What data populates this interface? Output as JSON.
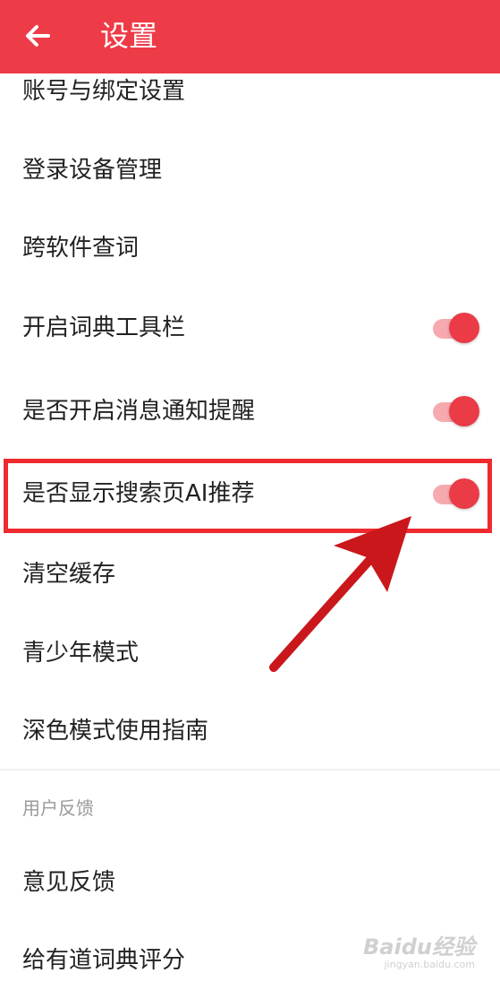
{
  "header": {
    "title": "设置",
    "back_icon": "arrow-left-icon",
    "background_color": "#ee3b48"
  },
  "settings": {
    "items": [
      {
        "label": "账号与绑定设置"
      },
      {
        "label": "登录设备管理"
      },
      {
        "label": "跨软件查词"
      },
      {
        "label": "开启词典工具栏",
        "toggle_on": true
      },
      {
        "label": "是否开启消息通知提醒",
        "toggle_on": true
      },
      {
        "label": "是否显示搜索页AI推荐",
        "toggle_on": true
      },
      {
        "label": "清空缓存"
      },
      {
        "label": "青少年模式"
      },
      {
        "label": "深色模式使用指南"
      }
    ]
  },
  "feedback_section": {
    "header": "用户反馈",
    "items": [
      {
        "label": "意见反馈"
      },
      {
        "label": "给有道词典评分"
      }
    ]
  },
  "annotation": {
    "highlight_color": "#ef2a2f",
    "arrow_color": "#c9171c"
  },
  "watermark": {
    "brand": "Baidu经验",
    "sub": "jingyan.baidu.com"
  },
  "colors": {
    "accent": "#ea3b47",
    "toggle_track": "#f6a9af"
  }
}
